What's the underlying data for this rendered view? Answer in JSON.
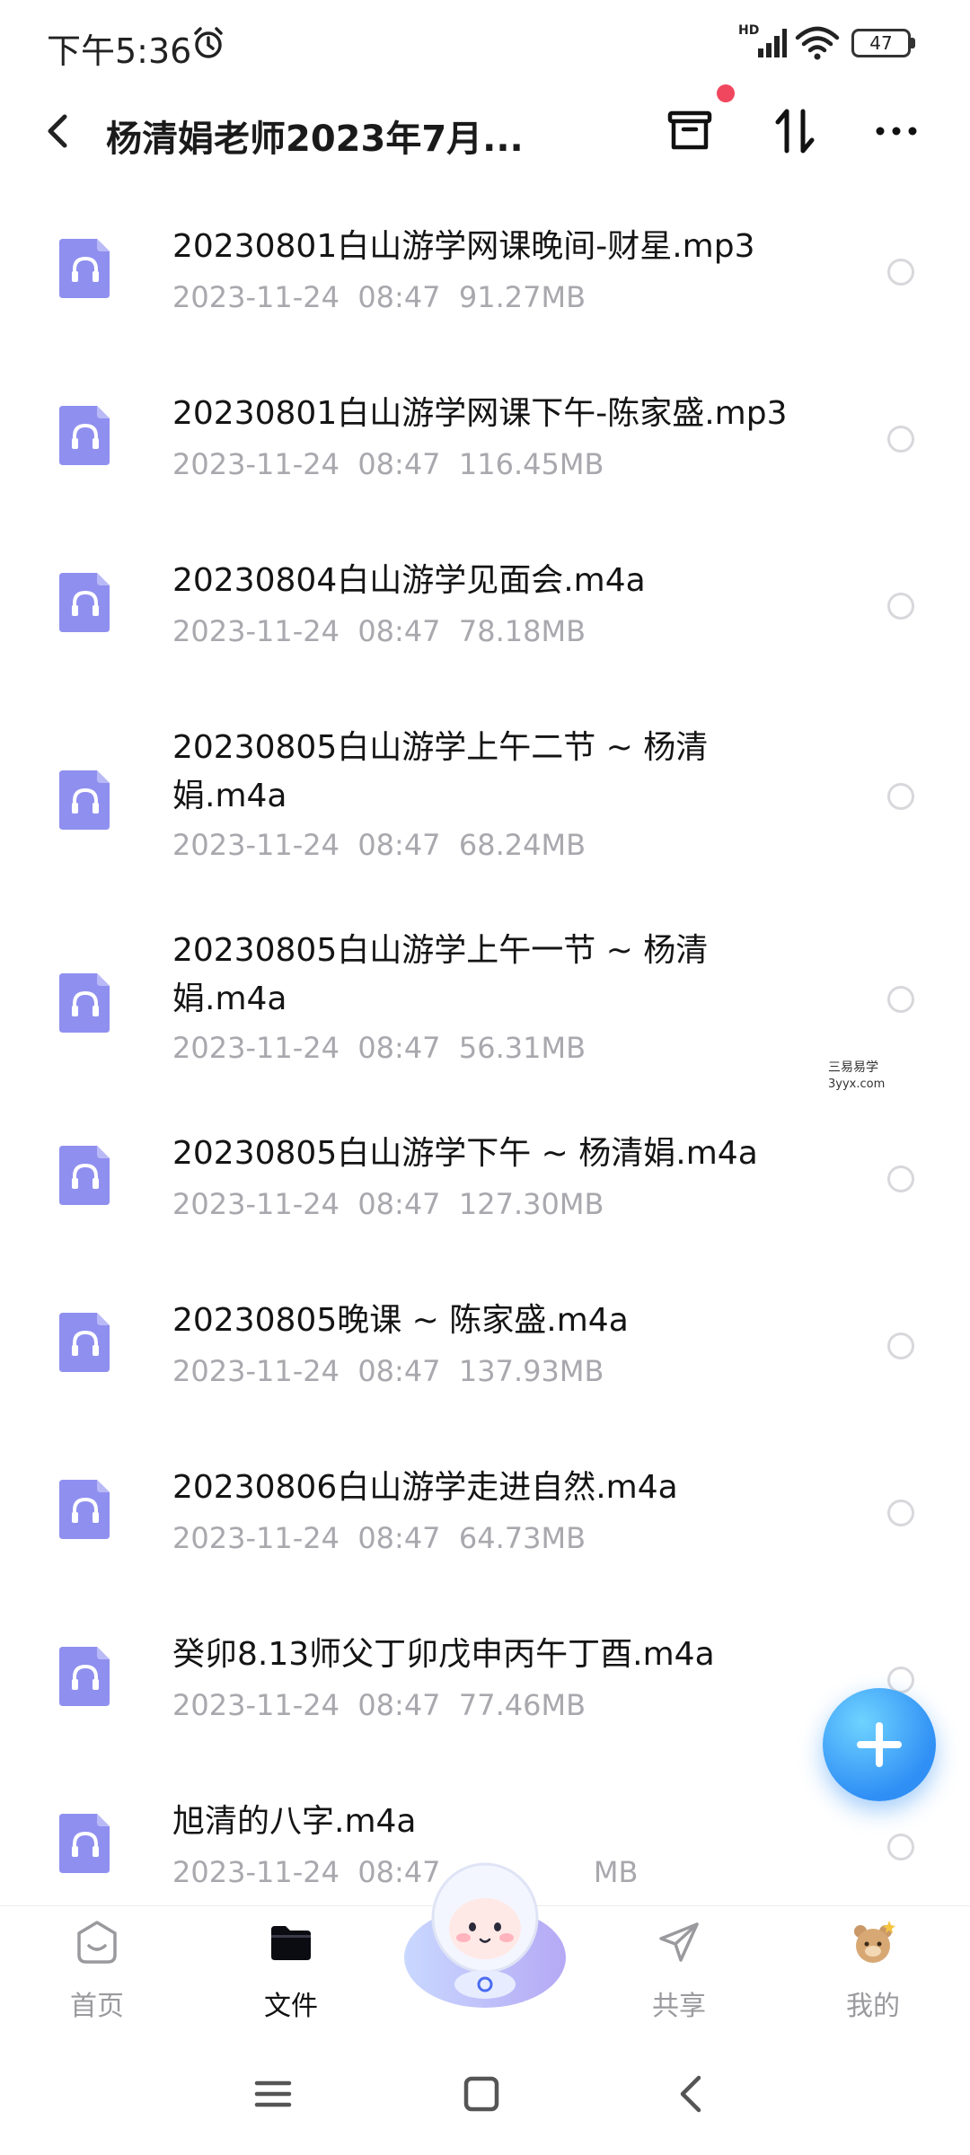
{
  "status_bar": {
    "time": "下午5:36",
    "network_label": "HD",
    "battery": "47"
  },
  "header": {
    "title": "杨清娟老师2023年7月..."
  },
  "files": [
    {
      "name": "20230801白山游学网课晚间-财星.mp3",
      "date": "2023-11-24",
      "time": "08:47",
      "size": "91.27MB"
    },
    {
      "name": "20230801白山游学网课下午-陈家盛.mp3",
      "date": "2023-11-24",
      "time": "08:47",
      "size": "116.45MB"
    },
    {
      "name": "20230804白山游学见面会.m4a",
      "date": "2023-11-24",
      "time": "08:47",
      "size": "78.18MB"
    },
    {
      "name": "20230805白山游学上午二节 ~ 杨清娟.m4a",
      "date": "2023-11-24",
      "time": "08:47",
      "size": "68.24MB"
    },
    {
      "name": "20230805白山游学上午一节 ~ 杨清娟.m4a",
      "date": "2023-11-24",
      "time": "08:47",
      "size": "56.31MB"
    },
    {
      "name": "20230805白山游学下午 ~ 杨清娟.m4a",
      "date": "2023-11-24",
      "time": "08:47",
      "size": "127.30MB"
    },
    {
      "name": "20230805晚课 ~ 陈家盛.m4a",
      "date": "2023-11-24",
      "time": "08:47",
      "size": "137.93MB"
    },
    {
      "name": "20230806白山游学走进自然.m4a",
      "date": "2023-11-24",
      "time": "08:47",
      "size": "64.73MB"
    },
    {
      "name": "癸卯8.13师父丁卯戊申丙午丁酉.m4a",
      "date": "2023-11-24",
      "time": "08:47",
      "size": "77.46MB"
    },
    {
      "name": "旭清的八字.m4a",
      "date": "2023-11-24",
      "time": "08:47",
      "size": "MB"
    }
  ],
  "watermark": {
    "line1": "三易易学",
    "line2": "3yyx.com"
  },
  "bottom_nav": {
    "home": "首页",
    "files": "文件",
    "share": "共享",
    "mine": "我的"
  },
  "colors": {
    "file_icon": "#8f8ff0",
    "accent_blue": "#2f8ff5",
    "badge_red": "#f0475e",
    "meta_gray": "#a8a8ae"
  },
  "icons": {
    "file": "headphones-audio-file-icon",
    "fab": "plus-icon"
  }
}
